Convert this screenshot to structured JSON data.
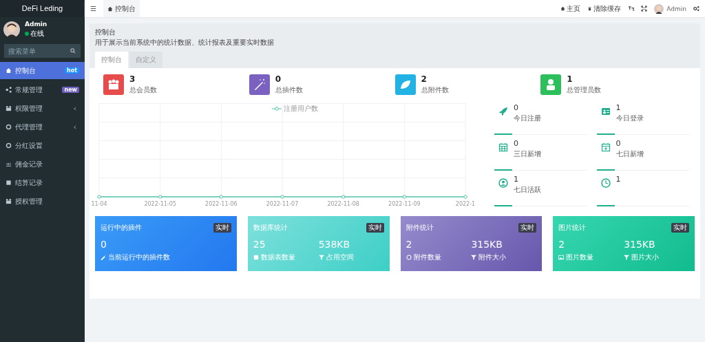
{
  "sidebar": {
    "logo": "DeFi Leding",
    "user": {
      "name": "Admin",
      "status": "在线"
    },
    "search": {
      "placeholder": "搜索菜单"
    },
    "items": [
      {
        "label": "控制台",
        "badge": {
          "text": "hot",
          "color": "#1e90ff"
        },
        "selected": true,
        "has_children": false
      },
      {
        "label": "常规管理",
        "badge": {
          "text": "new",
          "color": "#6f5fbf"
        },
        "selected": false,
        "has_children": false
      },
      {
        "label": "权限管理",
        "selected": false,
        "has_children": true
      },
      {
        "label": "代理管理",
        "selected": false,
        "has_children": true
      },
      {
        "label": "分红设置",
        "selected": false,
        "has_children": false
      },
      {
        "label": "佣金记录",
        "selected": false,
        "has_children": false
      },
      {
        "label": "结算记录",
        "selected": false,
        "has_children": false
      },
      {
        "label": "授权管理",
        "selected": false,
        "has_children": false
      }
    ]
  },
  "topbar": {
    "menu": "☰",
    "tab": "控制台",
    "links": [
      {
        "label": "主页"
      },
      {
        "label": "清除缓存"
      }
    ],
    "user": "Admin"
  },
  "page": {
    "title": "控制台",
    "description": "用于展示当前系统中的统计数据、统计报表及重要实时数据",
    "tabs": [
      {
        "label": "控制台",
        "selected": true
      },
      {
        "label": "自定义",
        "selected": false
      }
    ]
  },
  "stats": [
    {
      "value": "3",
      "label": "总会员数",
      "color": "#e74c4c"
    },
    {
      "value": "0",
      "label": "总插件数",
      "color": "#7b62c0"
    },
    {
      "value": "2",
      "label": "总附件数",
      "color": "#22b3e4"
    },
    {
      "value": "1",
      "label": "总管理员数",
      "color": "#2dbf5b"
    }
  ],
  "chart": {
    "legend": "注册用户数",
    "x_labels": [
      "11-04",
      "2022-11-05",
      "2022-11-06",
      "2022-11-07",
      "2022-11-08",
      "2022-11-09",
      "2022-1"
    ]
  },
  "mini_stats": [
    {
      "value": "0",
      "label": "今日注册"
    },
    {
      "value": "1",
      "label": "今日登录"
    },
    {
      "value": "0",
      "label": "三日新增"
    },
    {
      "value": "0",
      "label": "七日新增"
    },
    {
      "value": "1",
      "label": "七日活跃"
    },
    {
      "value": "1"
    }
  ],
  "cards": [
    {
      "title": "运行中的插件",
      "badge": "实时",
      "metrics": [
        {
          "value": "0",
          "label": "当前运行中的插件数"
        }
      ]
    },
    {
      "title": "数据库统计",
      "badge": "实时",
      "metrics": [
        {
          "value": "25",
          "label": "数据表数量"
        },
        {
          "value": "538KB",
          "label": "占用空间"
        }
      ]
    },
    {
      "title": "附件统计",
      "badge": "实时",
      "metrics": [
        {
          "value": "2",
          "label": "附件数量"
        },
        {
          "value": "315KB",
          "label": "附件大小"
        }
      ]
    },
    {
      "title": "图片统计",
      "badge": "实时",
      "metrics": [
        {
          "value": "2",
          "label": "图片数量"
        },
        {
          "value": "315KB",
          "label": "图片大小"
        }
      ]
    }
  ]
}
